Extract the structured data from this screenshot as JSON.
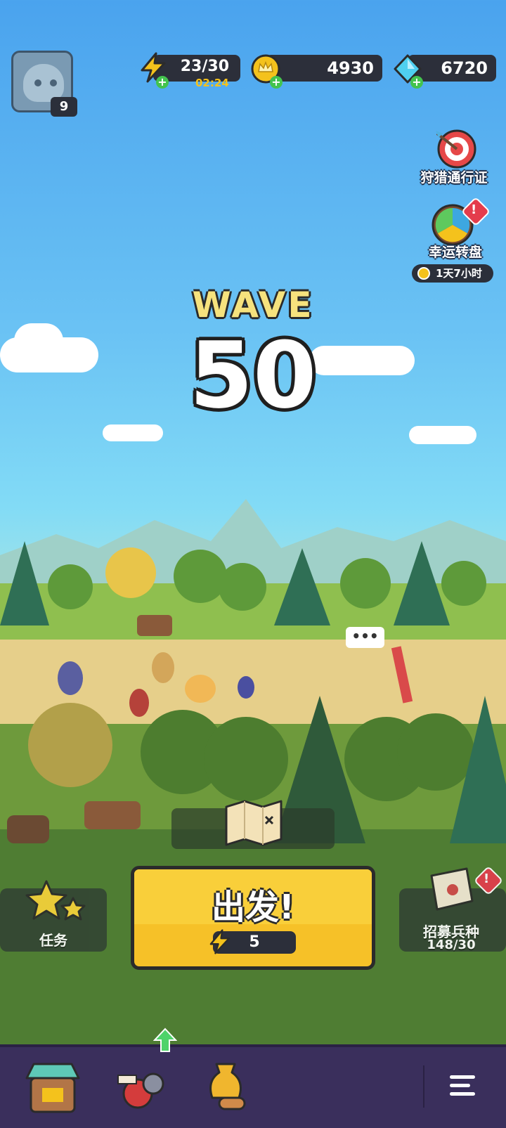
{
  "player": {
    "level": "9"
  },
  "resources": {
    "energy": {
      "value": "23/30",
      "timer": "02:24"
    },
    "gold": {
      "value": "4930"
    },
    "gems": {
      "value": "6720"
    }
  },
  "features": {
    "hunt_pass": {
      "label": "狩猎通行证"
    },
    "lucky_wheel": {
      "label": "幸运转盘",
      "time_left": "1天7小时"
    }
  },
  "wave": {
    "label": "WAVE",
    "number": "50"
  },
  "scene": {
    "chat_bubble": "•••"
  },
  "actions": {
    "go": {
      "label": "出发!",
      "cost": "5"
    },
    "quests": {
      "label": "任务"
    },
    "recruit": {
      "label": "招募兵种",
      "count": "148/30"
    }
  },
  "nav": {
    "items": [
      {
        "icon": "shop-icon"
      },
      {
        "icon": "army-icon"
      },
      {
        "icon": "treasure-icon"
      },
      {
        "icon": "menu-icon"
      }
    ]
  },
  "colors": {
    "accent": "#f6c128",
    "nav_bg": "#3a2f5c",
    "energy": "#f4c21c",
    "gem": "#4fd0f0"
  }
}
